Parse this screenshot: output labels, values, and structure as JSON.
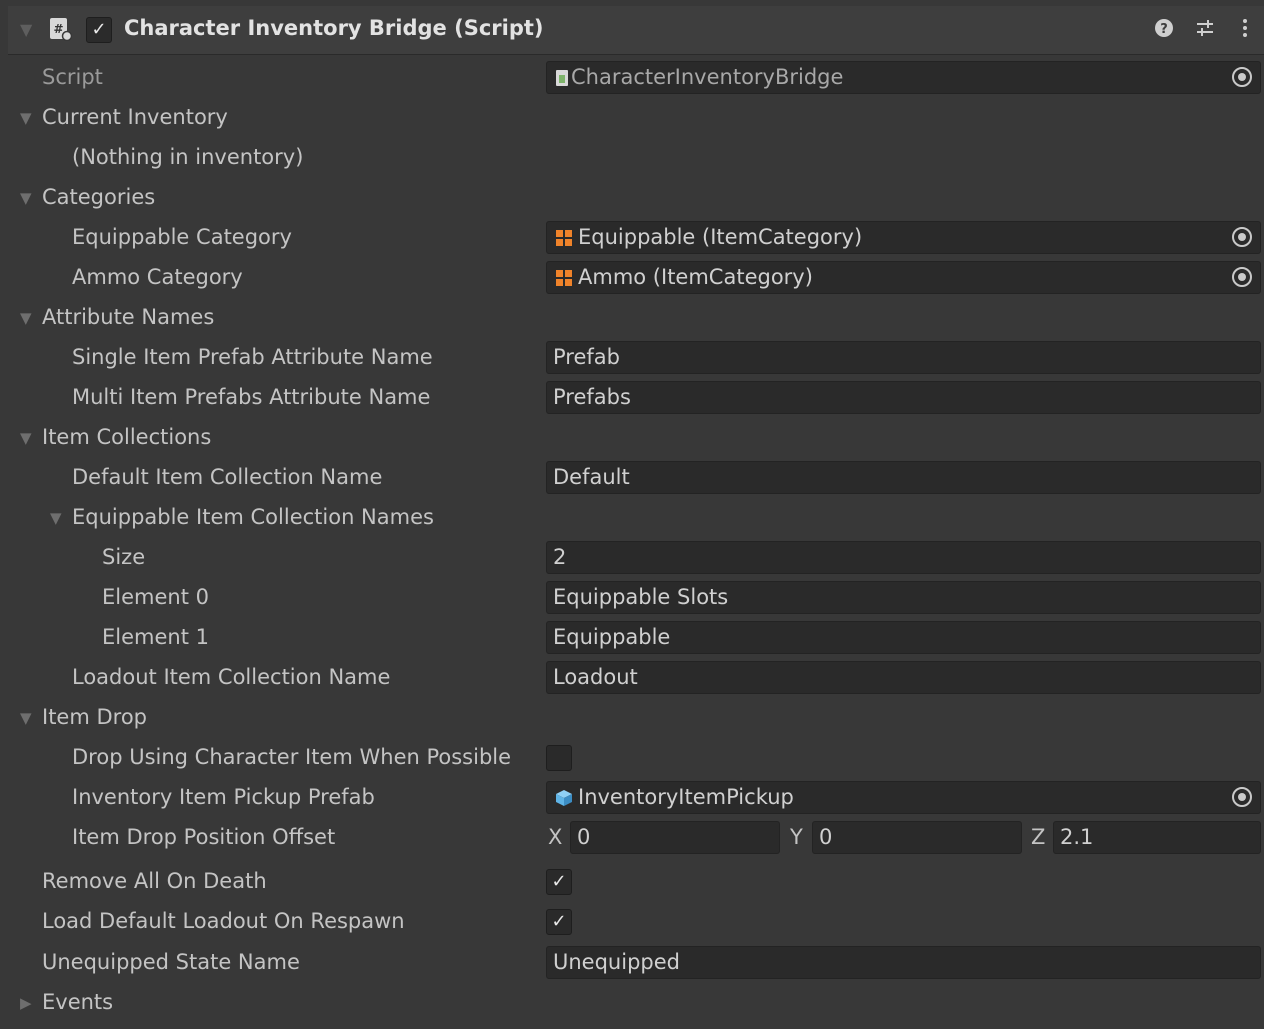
{
  "component": {
    "title": "Character Inventory Bridge (Script)",
    "enabled_check": "✓"
  },
  "script": {
    "label": "Script",
    "value": "CharacterInventoryBridge"
  },
  "current_inventory": {
    "label": "Current Inventory",
    "empty_text": "(Nothing in inventory)"
  },
  "categories": {
    "label": "Categories",
    "equippable": {
      "label": "Equippable Category",
      "value": "Equippable (ItemCategory)"
    },
    "ammo": {
      "label": "Ammo Category",
      "value": "Ammo (ItemCategory)"
    }
  },
  "attribute_names": {
    "label": "Attribute Names",
    "single": {
      "label": "Single Item Prefab Attribute Name",
      "value": "Prefab"
    },
    "multi": {
      "label": "Multi Item Prefabs Attribute Name",
      "value": "Prefabs"
    }
  },
  "item_collections": {
    "label": "Item Collections",
    "default": {
      "label": "Default Item Collection Name",
      "value": "Default"
    },
    "equippable_names": {
      "label": "Equippable Item Collection Names",
      "size_label": "Size",
      "size_value": "2",
      "elements": [
        {
          "label": "Element 0",
          "value": "Equippable Slots"
        },
        {
          "label": "Element 1",
          "value": "Equippable"
        }
      ]
    },
    "loadout": {
      "label": "Loadout Item Collection Name",
      "value": "Loadout"
    }
  },
  "item_drop": {
    "label": "Item Drop",
    "drop_using": {
      "label": "Drop Using Character Item When Possible",
      "checked": false
    },
    "pickup_prefab": {
      "label": "Inventory Item Pickup Prefab",
      "value": "InventoryItemPickup"
    },
    "offset": {
      "label": "Item Drop Position Offset",
      "x_label": "X",
      "x": "0",
      "y_label": "Y",
      "y": "0",
      "z_label": "Z",
      "z": "2.1"
    }
  },
  "remove_all_on_death": {
    "label": "Remove All On Death",
    "check": "✓"
  },
  "load_default_loadout": {
    "label": "Load Default Loadout On Respawn",
    "check": "✓"
  },
  "unequipped_state": {
    "label": "Unequipped State Name",
    "value": "Unequipped"
  },
  "events": {
    "label": "Events"
  },
  "colors": {
    "background": "#383838",
    "field": "#2a2a2a",
    "category_icon": "#f0832a",
    "prefab_icon": "#5fb4e6",
    "script_icon": "#7db36a"
  }
}
